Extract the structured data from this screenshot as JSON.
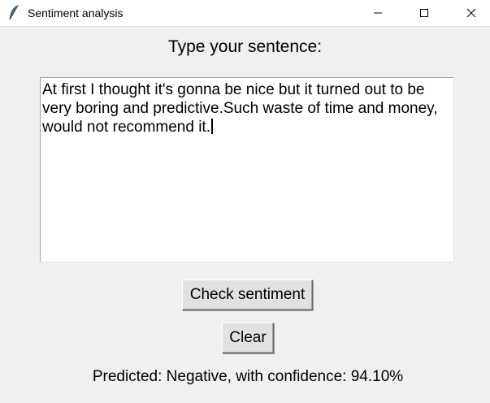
{
  "window": {
    "title": "Sentiment analysis",
    "app_icon": "feather-icon",
    "controls": [
      "minimize-icon",
      "maximize-icon",
      "close-icon"
    ]
  },
  "main": {
    "prompt": "Type your sentence:",
    "input_lines": [
      "At first I thought it's gonna be nice but it turned out to be",
      "very boring and predictive.Such waste of time and money,",
      "would not recommend it."
    ],
    "check_button": "Check sentiment",
    "clear_button": "Clear",
    "result": "Predicted: Negative, with confidence: 94.10%"
  }
}
